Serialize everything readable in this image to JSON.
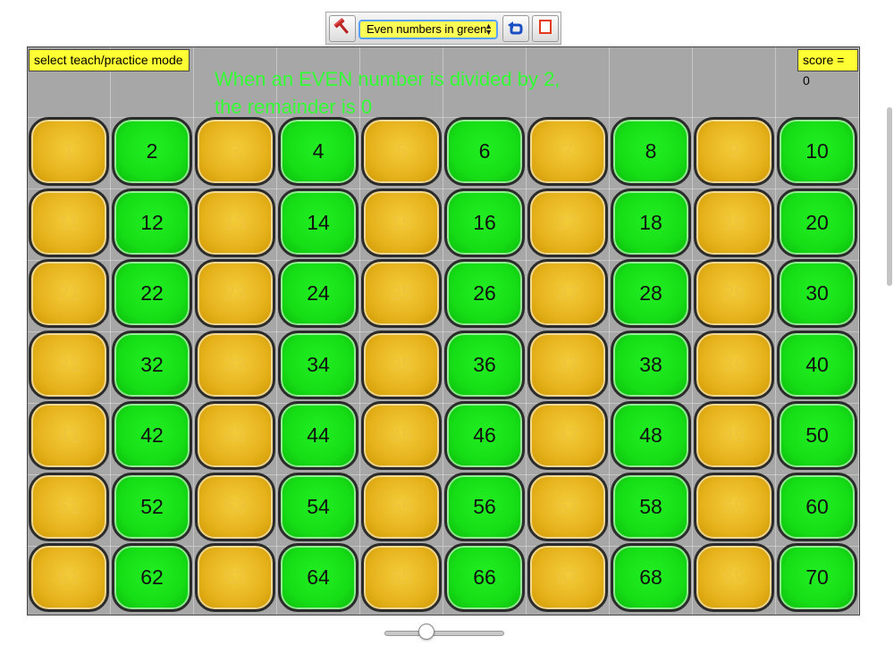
{
  "toolbar": {
    "mode_select": {
      "selected": "Even numbers in green"
    },
    "colors": {
      "select_bg": "#ffff55",
      "select_border": "#5aa0ff"
    }
  },
  "stage": {
    "mode_label": "select teach/practice mode",
    "score_label": "score = 0",
    "instruction_line1": "When an EVEN number is divided by 2,",
    "instruction_line2": "the remainder is 0"
  },
  "grid": {
    "columns": 10,
    "rows": 7,
    "numbers": [
      1,
      2,
      3,
      4,
      5,
      6,
      7,
      8,
      9,
      10,
      11,
      12,
      13,
      14,
      15,
      16,
      17,
      18,
      19,
      20,
      21,
      22,
      23,
      24,
      25,
      26,
      27,
      28,
      29,
      30,
      31,
      32,
      33,
      34,
      35,
      36,
      37,
      38,
      39,
      40,
      41,
      42,
      43,
      44,
      45,
      46,
      47,
      48,
      49,
      50,
      51,
      52,
      53,
      54,
      55,
      56,
      57,
      58,
      59,
      60,
      61,
      62,
      63,
      64,
      65,
      66,
      67,
      68,
      69,
      70
    ],
    "colors": {
      "even": "#16de16",
      "odd": "#e6b21c",
      "background": "#a7a7a7",
      "instruction": "#33ff33",
      "label_bg": "#ffff33"
    }
  },
  "slider": {
    "value": 0.35
  },
  "icons": [
    "hammer-icon",
    "undo-icon",
    "stop-icon"
  ]
}
